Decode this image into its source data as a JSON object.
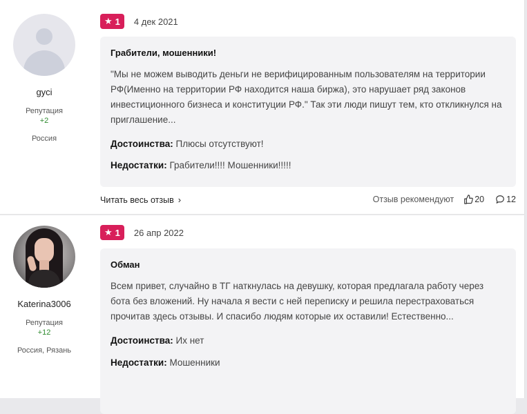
{
  "reviews": [
    {
      "user": {
        "name": "gyci",
        "reputation_label": "Репутация",
        "reputation": "+2",
        "location": "Россия"
      },
      "rating": "1",
      "date": "4 дек 2021",
      "title": "Грабители, мошенники!",
      "text": "\"Мы не можем выводить деньги не верифицированным пользователям на территории РФ(Именно на территории РФ находится наша биржа), это нарушает ряд законов инвестиционного бизнеса и конституции РФ.\" Так эти люди пишут тем, кто откликнулся на приглашение...",
      "pros_label": "Достоинства:",
      "pros": " Плюсы отсутствуют!",
      "cons_label": "Недостатки:",
      "cons": " Грабители!!!! Мошенники!!!!!",
      "read_more": "Читать весь отзыв",
      "recommend": "Отзыв рекомендуют",
      "likes": "20",
      "comments": "12"
    },
    {
      "user": {
        "name": "Katerina3006",
        "reputation_label": "Репутация",
        "reputation": "+12",
        "location": "Россия, Рязань"
      },
      "rating": "1",
      "date": "26 апр 2022",
      "title": "Обман",
      "text": "Всем привет, случайно в ТГ наткнулась на девушку, которая предлагала работу через бота без вложений. Ну начала я вести с ней переписку и решила перестраховаться прочитав здесь отзывы. И спасибо людям которые их оставили! Естественно...",
      "pros_label": "Достоинства:",
      "pros": " Их нет",
      "cons_label": "Недостатки:",
      "cons": " Мошенники"
    }
  ],
  "colors": {
    "badge": "#d81f5a",
    "reputation": "#2e8b2e",
    "box": "#f3f3f5"
  },
  "icons": {
    "star": "star-icon",
    "chevron": "chevron-right-icon",
    "like": "thumb-up-icon",
    "comment": "comment-icon"
  }
}
